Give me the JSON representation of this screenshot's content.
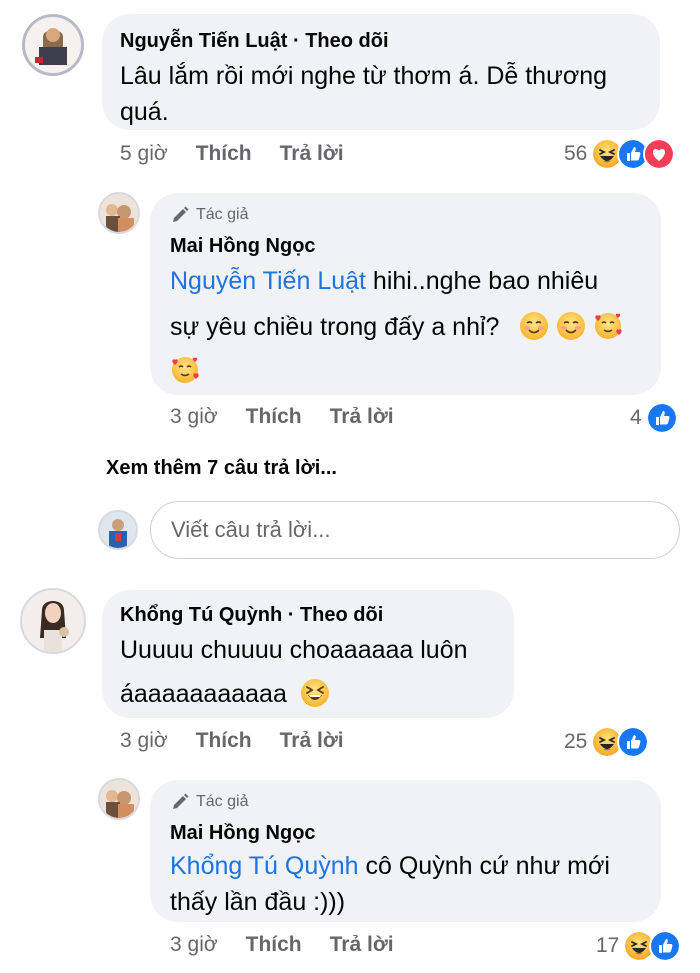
{
  "comments": [
    {
      "name": "Nguyễn Tiến Luật",
      "follow": "Theo dõi",
      "text": "Lâu lắm rồi mới nghe từ thơm á. Dễ thương quá.",
      "text_line1": "Lâu lắm rồi mới nghe từ thơm á. Dễ thương",
      "text_line2": "quá.",
      "time": "5 giờ",
      "like": "Thích",
      "reply": "Trả lời",
      "reaction_count": "56",
      "reactions": [
        "haha",
        "like",
        "love"
      ]
    },
    {
      "badge": "Tác giả",
      "name": "Mai Hồng Ngọc",
      "mention": "Nguyễn Tiến Luật",
      "text_line1": " hihi..nghe bao nhiêu",
      "text_line2": "sự yêu chiều trong đấy a nhỉ?",
      "time": "3 giờ",
      "like": "Thích",
      "reply": "Trả lời",
      "reaction_count": "4",
      "reactions": [
        "like"
      ]
    },
    {
      "name": "Khổng Tú Quỳnh",
      "follow": "Theo dõi",
      "text_line1": "Uuuuu chuuuu choaaaaaa luôn",
      "text_line2": "áaaaaaaaaaaa",
      "time": "3 giờ",
      "like": "Thích",
      "reply": "Trả lời",
      "reaction_count": "25",
      "reactions": [
        "haha",
        "like"
      ]
    },
    {
      "badge": "Tác giả",
      "name": "Mai Hồng Ngọc",
      "mention": "Khổng Tú Quỳnh",
      "text_line1": " cô Quỳnh cứ như mới",
      "text_line2": "thấy lần đầu :)))",
      "time": "3 giờ",
      "like": "Thích",
      "reply": "Trả lời",
      "reaction_count": "17",
      "reactions": [
        "haha",
        "like"
      ]
    }
  ],
  "see_more": "Xem thêm 7 câu trả lời...",
  "reply_box": {
    "placeholder": "Viết câu trả lời..."
  },
  "colors": {
    "link": "#1b74e4",
    "bubble": "#f0f2f5",
    "meta": "#65676b",
    "like": "#1877f2",
    "love": "#f33e58",
    "haha": "#f7b125"
  }
}
